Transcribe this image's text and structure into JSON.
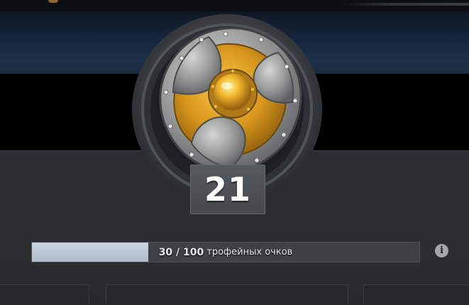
{
  "medal": {
    "icon": "shield-medal-icon",
    "level": "21"
  },
  "trophy_progress": {
    "current": 30,
    "max": 100,
    "separator": "/",
    "unit_label": "трофейных очков",
    "fill_fraction": 0.3
  },
  "info_button": {
    "icon": "info-icon",
    "glyph": "i"
  },
  "colors": {
    "progress_fill": "#aebccd",
    "shield_gold": "#d9971c",
    "shield_steel": "#9a9c9c"
  }
}
